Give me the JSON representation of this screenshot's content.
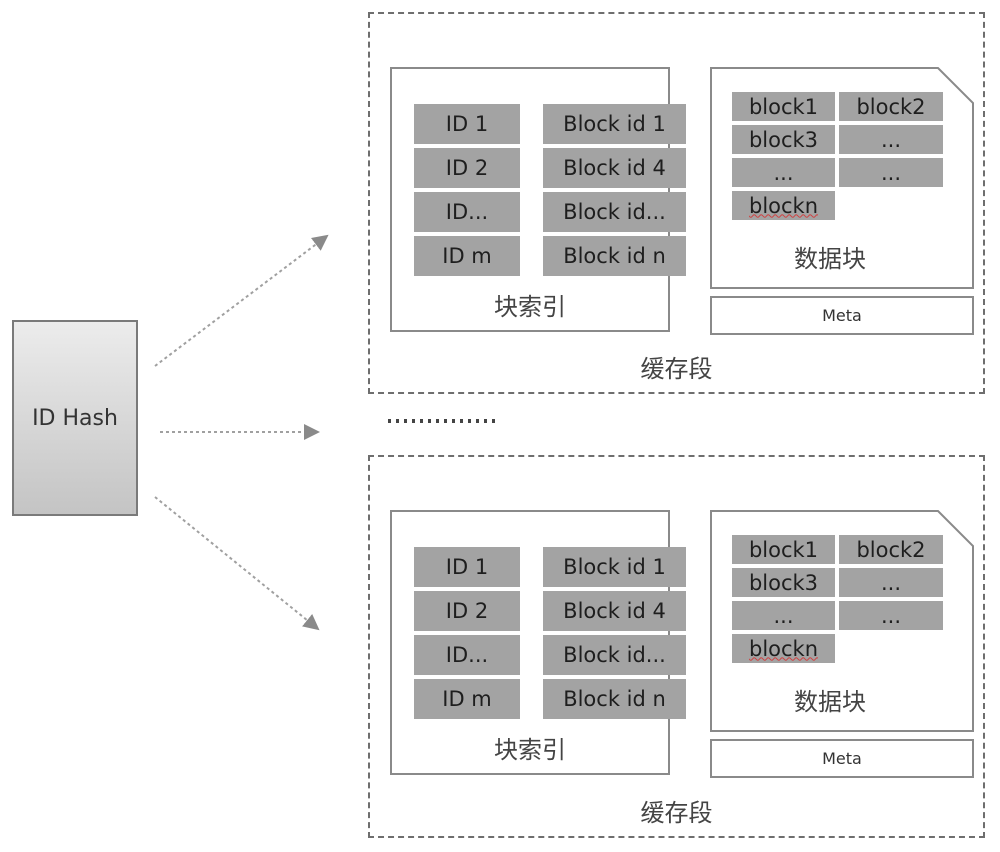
{
  "hash_box": {
    "label": "ID Hash"
  },
  "separator": {
    "label": "..............."
  },
  "segments": [
    {
      "label": "缓存段",
      "index": {
        "label": "块索引",
        "ids": [
          "ID 1",
          "ID 2",
          "ID...",
          "ID m"
        ],
        "block_ids": [
          "Block id 1",
          "Block id 4",
          "Block id...",
          "Block id n"
        ]
      },
      "data": {
        "label": "数据块",
        "blocks": [
          "block1",
          "block2",
          "block3",
          "...",
          "...",
          "...",
          "blockn"
        ]
      },
      "meta": {
        "label": "Meta"
      }
    },
    {
      "label": "缓存段",
      "index": {
        "label": "块索引",
        "ids": [
          "ID 1",
          "ID 2",
          "ID...",
          "ID m"
        ],
        "block_ids": [
          "Block id 1",
          "Block id 4",
          "Block id...",
          "Block id n"
        ]
      },
      "data": {
        "label": "数据块",
        "blocks": [
          "block1",
          "block2",
          "block3",
          "...",
          "...",
          "...",
          "blockn"
        ]
      },
      "meta": {
        "label": "Meta"
      }
    }
  ],
  "colors": {
    "cell_fill": "#a3a3a3",
    "border": "#8a8a8a",
    "dashed_border": "#6e6e6e",
    "arrow": "#9a9a9a"
  }
}
